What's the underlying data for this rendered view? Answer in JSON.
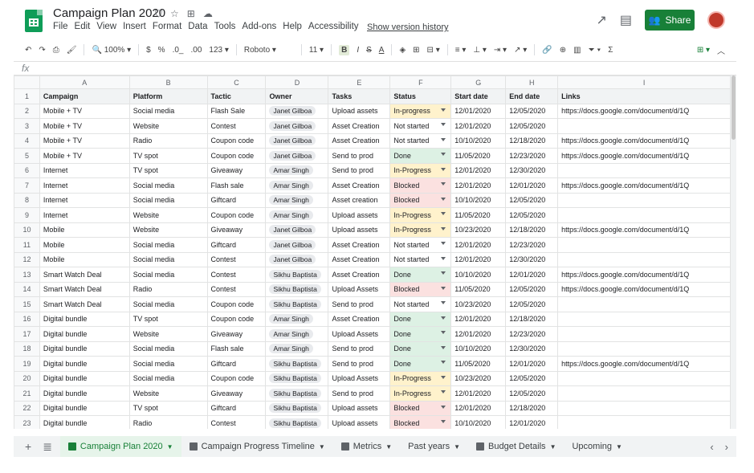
{
  "header": {
    "title": "Campaign Plan 2020",
    "menus": [
      "File",
      "Edit",
      "View",
      "Insert",
      "Format",
      "Data",
      "Tools",
      "Add-ons",
      "Help",
      "Accessibility"
    ],
    "version_link": "Show version history",
    "share_label": "Share"
  },
  "toolbar": {
    "zoom": "100%",
    "currency": "$",
    "percent": "%",
    "dec_less": ".0_",
    "dec_more": ".00",
    "format_123": "123",
    "font": "Roboto",
    "font_size": "11"
  },
  "formula": {
    "fx_label": "fx"
  },
  "grid": {
    "columns": [
      "A",
      "B",
      "C",
      "D",
      "E",
      "F",
      "G",
      "H",
      "I"
    ],
    "headers": [
      "Campaign",
      "Platform",
      "Tactic",
      "Owner",
      "Tasks",
      "Status",
      "Start date",
      "End date",
      "Links"
    ],
    "rows": [
      {
        "n": "2",
        "campaign": "Mobile + TV",
        "platform": "Social media",
        "tactic": "Flash Sale",
        "owner": "Janet Gilboa",
        "task": "Upload assets",
        "status": "In-progress",
        "st": "progress",
        "start": "12/01/2020",
        "end": "12/05/2020",
        "link": "https://docs.google.com/document/d/1Q"
      },
      {
        "n": "3",
        "campaign": "Mobile + TV",
        "platform": "Website",
        "tactic": "Contest",
        "owner": "Janet Gilboa",
        "task": "Asset Creation",
        "status": "Not started",
        "st": "not",
        "start": "12/01/2020",
        "end": "12/05/2020",
        "link": ""
      },
      {
        "n": "4",
        "campaign": "Mobile + TV",
        "platform": "Radio",
        "tactic": "Coupon code",
        "owner": "Janet Gilboa",
        "task": "Asset Creation",
        "status": "Not started",
        "st": "not",
        "start": "10/10/2020",
        "end": "12/18/2020",
        "link": "https://docs.google.com/document/d/1Q"
      },
      {
        "n": "5",
        "campaign": "Mobile + TV",
        "platform": "TV spot",
        "tactic": "Coupon code",
        "owner": "Janet Gilboa",
        "task": "Send to prod",
        "status": "Done",
        "st": "done",
        "start": "11/05/2020",
        "end": "12/23/2020",
        "link": "https://docs.google.com/document/d/1Q"
      },
      {
        "n": "6",
        "campaign": "Internet",
        "platform": "TV spot",
        "tactic": "Giveaway",
        "owner": "Amar Singh",
        "task": "Send to prod",
        "status": "In-Progress",
        "st": "progress",
        "start": "12/01/2020",
        "end": "12/30/2020",
        "link": ""
      },
      {
        "n": "7",
        "campaign": "Internet",
        "platform": "Social media",
        "tactic": "Flash sale",
        "owner": "Amar Singh",
        "task": "Asset Creation",
        "status": "Blocked",
        "st": "blocked",
        "start": "12/01/2020",
        "end": "12/01/2020",
        "link": "https://docs.google.com/document/d/1Q"
      },
      {
        "n": "8",
        "campaign": "Internet",
        "platform": "Social media",
        "tactic": "Giftcard",
        "owner": "Amar Singh",
        "task": "Asset creation",
        "status": "Blocked",
        "st": "blocked",
        "start": "10/10/2020",
        "end": "12/05/2020",
        "link": ""
      },
      {
        "n": "9",
        "campaign": "Internet",
        "platform": "Website",
        "tactic": "Coupon code",
        "owner": "Amar Singh",
        "task": "Upload assets",
        "status": "In-Progress",
        "st": "progress",
        "start": "11/05/2020",
        "end": "12/05/2020",
        "link": ""
      },
      {
        "n": "10",
        "campaign": "Mobile",
        "platform": "Website",
        "tactic": "Giveaway",
        "owner": "Janet Gilboa",
        "task": "Upload assets",
        "status": "In-Progress",
        "st": "progress",
        "start": "10/23/2020",
        "end": "12/18/2020",
        "link": "https://docs.google.com/document/d/1Q"
      },
      {
        "n": "11",
        "campaign": "Mobile",
        "platform": "Social media",
        "tactic": "Giftcard",
        "owner": "Janet Gilboa",
        "task": "Asset Creation",
        "status": "Not started",
        "st": "not",
        "start": "12/01/2020",
        "end": "12/23/2020",
        "link": ""
      },
      {
        "n": "12",
        "campaign": "Mobile",
        "platform": "Social media",
        "tactic": "Contest",
        "owner": "Janet Gilboa",
        "task": "Asset Creation",
        "status": "Not started",
        "st": "not",
        "start": "12/01/2020",
        "end": "12/30/2020",
        "link": ""
      },
      {
        "n": "13",
        "campaign": "Smart Watch Deal",
        "platform": "Social media",
        "tactic": "Contest",
        "owner": "Sikhu Baptista",
        "task": "Asset Creation",
        "status": "Done",
        "st": "done",
        "start": "10/10/2020",
        "end": "12/01/2020",
        "link": "https://docs.google.com/document/d/1Q"
      },
      {
        "n": "14",
        "campaign": "Smart Watch Deal",
        "platform": "Radio",
        "tactic": "Contest",
        "owner": "Sikhu Baptista",
        "task": "Upload Assets",
        "status": "Blocked",
        "st": "blocked",
        "start": "11/05/2020",
        "end": "12/05/2020",
        "link": "https://docs.google.com/document/d/1Q"
      },
      {
        "n": "15",
        "campaign": "Smart Watch Deal",
        "platform": "Social media",
        "tactic": "Coupon code",
        "owner": "Sikhu Baptista",
        "task": "Send to prod",
        "status": "Not started",
        "st": "not",
        "start": "10/23/2020",
        "end": "12/05/2020",
        "link": ""
      },
      {
        "n": "16",
        "campaign": "Digital bundle",
        "platform": "TV spot",
        "tactic": "Coupon code",
        "owner": "Amar Singh",
        "task": "Asset Creation",
        "status": "Done",
        "st": "done",
        "start": "12/01/2020",
        "end": "12/18/2020",
        "link": ""
      },
      {
        "n": "17",
        "campaign": "Digital bundle",
        "platform": "Website",
        "tactic": "Giveaway",
        "owner": "Amar Singh",
        "task": "Upload Assets",
        "status": "Done",
        "st": "done",
        "start": "12/01/2020",
        "end": "12/23/2020",
        "link": ""
      },
      {
        "n": "18",
        "campaign": "Digital bundle",
        "platform": "Social media",
        "tactic": "Flash sale",
        "owner": "Amar Singh",
        "task": "Send to prod",
        "status": "Done",
        "st": "done",
        "start": "10/10/2020",
        "end": "12/30/2020",
        "link": ""
      },
      {
        "n": "19",
        "campaign": "Digital bundle",
        "platform": "Social media",
        "tactic": "Giftcard",
        "owner": "Sikhu Baptista",
        "task": "Send to prod",
        "status": "Done",
        "st": "done",
        "start": "11/05/2020",
        "end": "12/01/2020",
        "link": "https://docs.google.com/document/d/1Q"
      },
      {
        "n": "20",
        "campaign": "Digital bundle",
        "platform": "Social media",
        "tactic": "Coupon code",
        "owner": "Sikhu Baptista",
        "task": "Upload Assets",
        "status": "In-Progress",
        "st": "progress",
        "start": "10/23/2020",
        "end": "12/05/2020",
        "link": ""
      },
      {
        "n": "21",
        "campaign": "Digital bundle",
        "platform": "Website",
        "tactic": "Giveaway",
        "owner": "Sikhu Baptista",
        "task": "Send to prod",
        "status": "In-Progress",
        "st": "progress",
        "start": "12/01/2020",
        "end": "12/05/2020",
        "link": ""
      },
      {
        "n": "22",
        "campaign": "Digital bundle",
        "platform": "TV spot",
        "tactic": "Giftcard",
        "owner": "Sikhu Baptista",
        "task": "Upload assets",
        "status": "Blocked",
        "st": "blocked",
        "start": "12/01/2020",
        "end": "12/18/2020",
        "link": ""
      },
      {
        "n": "23",
        "campaign": "Digital bundle",
        "platform": "Radio",
        "tactic": "Contest",
        "owner": "Sikhu Baptista",
        "task": "Upload assets",
        "status": "Blocked",
        "st": "blocked",
        "start": "10/10/2020",
        "end": "12/01/2020",
        "link": ""
      }
    ]
  },
  "sheet_tabs": [
    {
      "label": "Campaign Plan 2020",
      "icon": "sheet-icon",
      "color": "#188038",
      "active": true
    },
    {
      "label": "Campaign Progress Timeline",
      "icon": "timeline-icon",
      "color": "#5f6368",
      "active": false
    },
    {
      "label": "Metrics",
      "icon": "chart-icon",
      "color": "#5f6368",
      "active": false
    },
    {
      "label": "Past years",
      "icon": "",
      "color": "",
      "active": false
    },
    {
      "label": "Budget Details",
      "icon": "chart-icon",
      "color": "#5f6368",
      "active": false
    },
    {
      "label": "Upcoming",
      "icon": "",
      "color": "",
      "active": false
    }
  ]
}
